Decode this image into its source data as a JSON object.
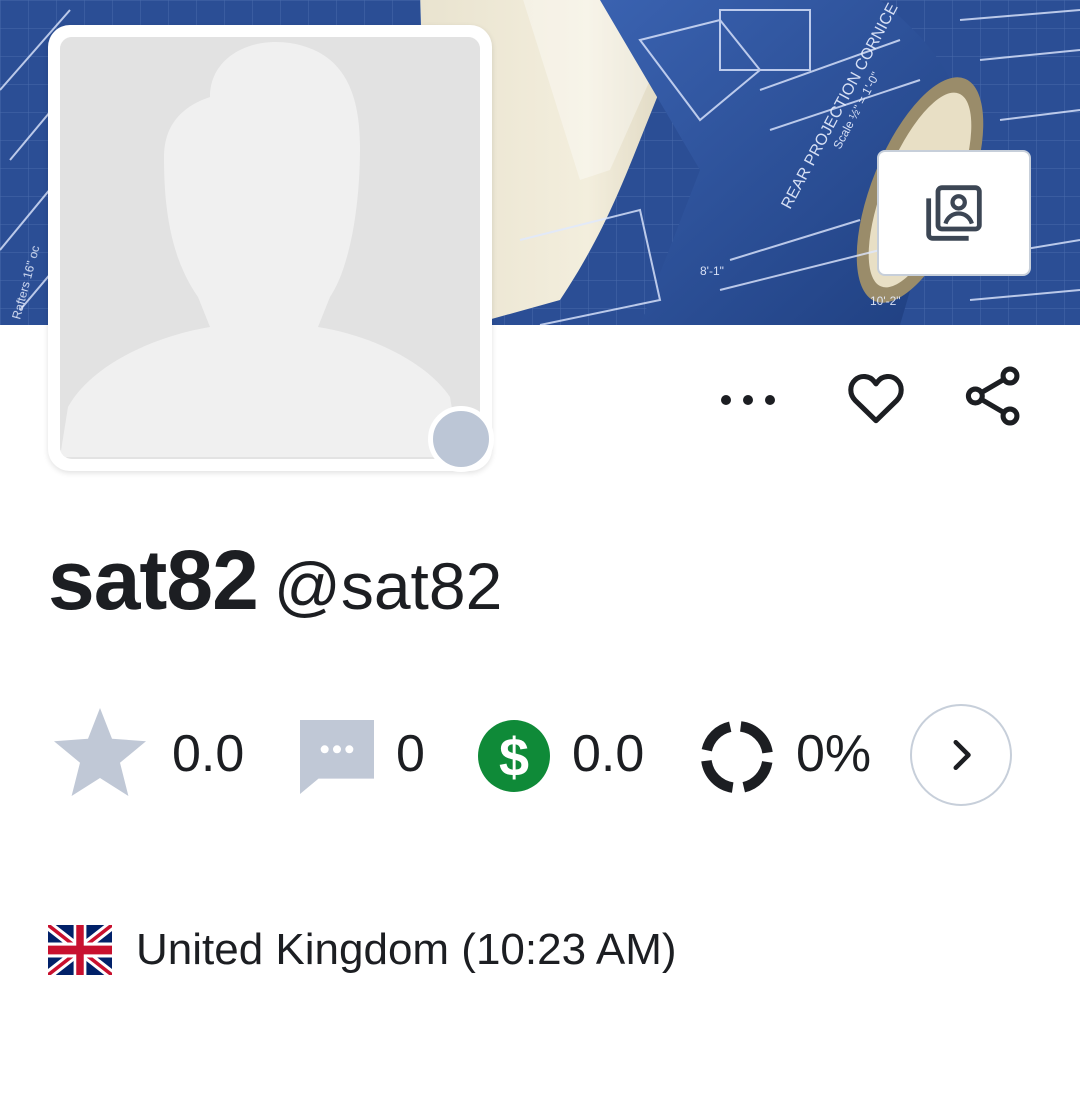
{
  "profile": {
    "display_name": "sat82",
    "username": "@sat82",
    "location": "United Kingdom (10:23 AM)",
    "status_color": "#bcc6d6"
  },
  "cover": {
    "edit_icon": "photo-gallery-icon"
  },
  "actions": {
    "more_icon": "more-horizontal-icon",
    "favorite_icon": "heart-icon",
    "share_icon": "share-icon"
  },
  "stats": {
    "rating": "0.0",
    "reviews": "0",
    "earnings": "0.0",
    "completion": "0%",
    "completion_fraction": 0.0,
    "earnings_color": "#0f8a38",
    "icon_color": "#c0c8d6"
  }
}
